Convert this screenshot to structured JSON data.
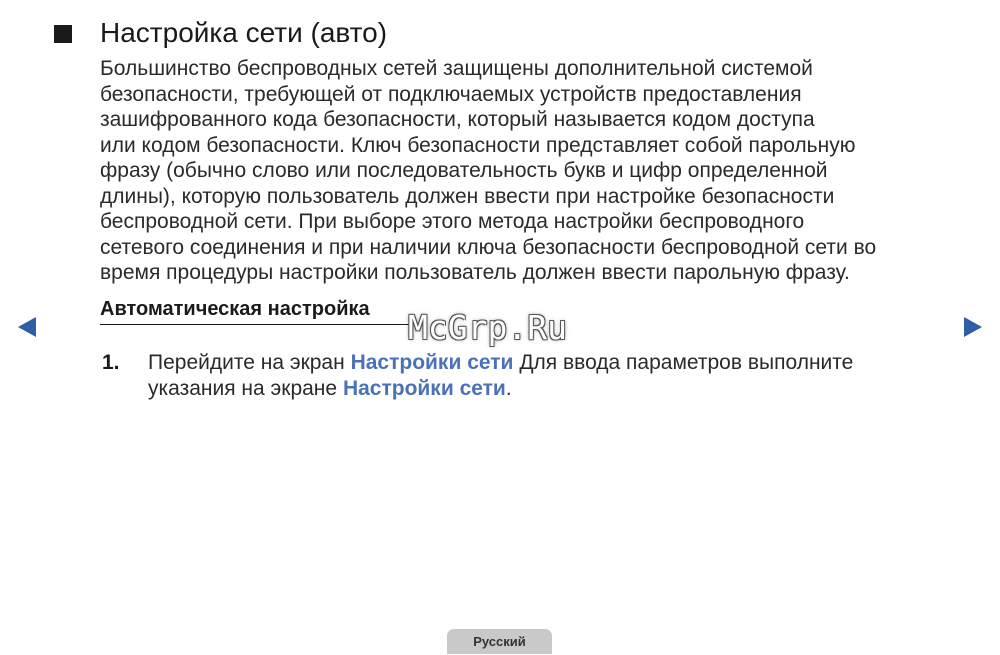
{
  "title": "Настройка сети (авто)",
  "intro_lines": [
    "Большинство беспроводных сетей защищены дополнительной системой",
    "безопасности, требующей от подключаемых устройств предоставления",
    "зашифрованного кода безопасности, который называется кодом доступа",
    "или кодом безопасности. Ключ безопасности представляет собой парольную",
    "фразу (обычно слово или последовательность букв и цифр определенной",
    "длины), которую пользователь должен ввести при настройке безопасности",
    "беспроводной сети. При выборе этого метода настройки беспроводного",
    "сетевого соединения и при наличии ключа безопасности беспроводной сети во",
    "время процедуры настройки пользователь должен ввести парольную фразу."
  ],
  "subheading": "Автоматическая настройка",
  "watermark": "McGrp.Ru",
  "step": {
    "number": "1.",
    "text_1": "Перейдите на экран",
    "link_1": "Настройки сети",
    "text_2": "Для ввода параметров выполните",
    "text_3": "указания на экране",
    "link_2": "Настройки сети",
    "text_4": "."
  },
  "language_tab": "Русский",
  "nav": {
    "prev_icon": "triangle-left-icon",
    "next_icon": "triangle-right-icon"
  },
  "colors": {
    "link": "#4a72b8",
    "nav_arrow": "#2f5ea6",
    "tab": "#c9c9c9"
  }
}
